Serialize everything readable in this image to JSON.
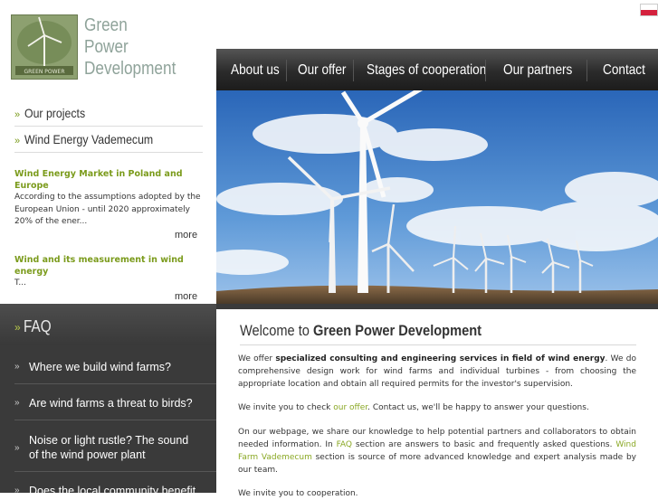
{
  "brand": {
    "logo_name": "green-power-logo",
    "logo_lines": [
      "Green",
      "Power",
      "Development"
    ]
  },
  "lang_flag": "poland-flag",
  "nav": {
    "items": [
      "About us",
      "Our offer",
      "Stages of cooperation",
      "Our partners",
      "Contact"
    ]
  },
  "sidebar": {
    "links": [
      "Our projects",
      "Wind Energy Vademecum"
    ],
    "news": [
      {
        "title": "Wind Energy Market in Poland and Europe",
        "text": "According to the assumptions adopted by the European Union - until 2020 approximately 20% of the ener...",
        "more": "more"
      },
      {
        "title": "Wind and its measurement in wind energy",
        "text": "T...",
        "more": "more"
      }
    ]
  },
  "faq": {
    "title": "FAQ",
    "questions": [
      "Where we build wind farms?",
      "Are wind farms a threat to birds?",
      "Noise or light rustle? The sound of the wind power plant",
      "Does the local community benefit"
    ]
  },
  "hero": {
    "image": "wind-turbines-photo"
  },
  "welcome": {
    "title_prefix": "Welcome to ",
    "title_bold": "Green Power Development",
    "p1": {
      "a": "We offer ",
      "b": "specialized consulting and engineering services in field of wind energy",
      "c": ". We do comprehensive design work for wind farms and individual turbines - from choosing the appropriate location and obtain all required permits for the investor's supervision."
    },
    "p2": {
      "a": "We invite you to check ",
      "link": "our offer",
      "c": ". Contact us, we'll be happy to answer your questions."
    },
    "p3": {
      "a": "On our webpage, we share our knowledge to help potential partners and collaborators to obtain needed information. In ",
      "link1": "FAQ",
      "b": " section are answers to basic and frequently asked questions. ",
      "link2": "Wind Farm Vademecum",
      "c": " section is source of more advanced knowledge and expert analysis made by our team."
    },
    "p4": "We invite you to cooperation."
  },
  "colors": {
    "accent_green": "#7b9b1c",
    "nav_bg": "#2b2b2b",
    "faq_bg": "#3a3a3a",
    "logo_text": "#8fa39a"
  }
}
